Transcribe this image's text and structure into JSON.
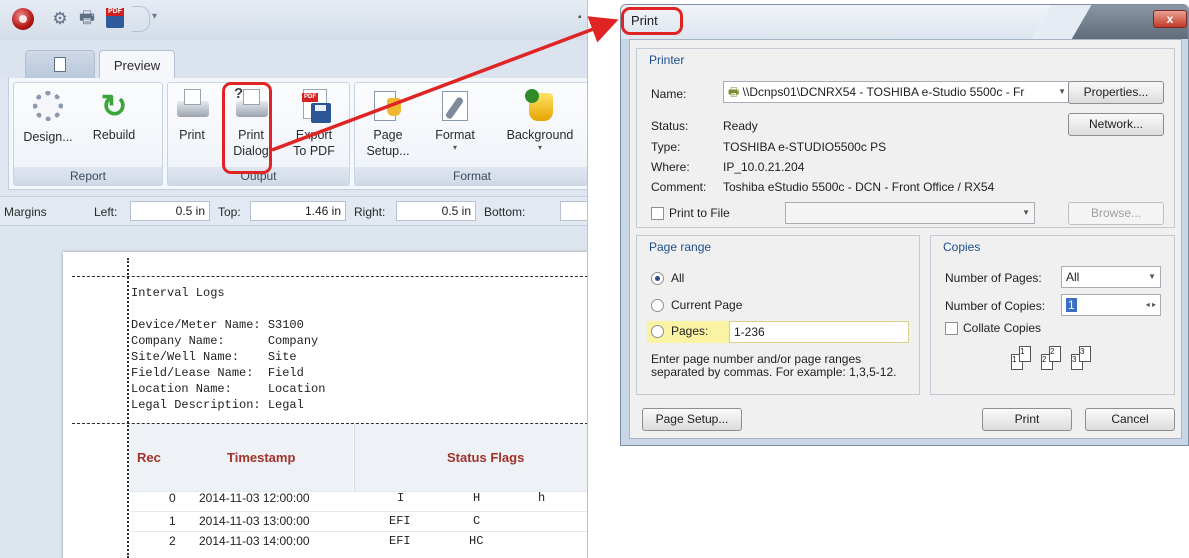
{
  "app": {
    "tabs": {
      "preview": "Preview"
    },
    "ribbon": {
      "report": {
        "label": "Report",
        "design": "Design...",
        "rebuild": "Rebuild"
      },
      "output": {
        "label": "Output",
        "print": "Print",
        "print_dialog_1": "Print",
        "print_dialog_2": "Dialog",
        "export_1": "Export",
        "export_2": "To PDF"
      },
      "format": {
        "label": "Format",
        "page_setup_1": "Page",
        "page_setup_2": "Setup...",
        "format": "Format",
        "background": "Background"
      }
    },
    "margins": {
      "title": "Margins",
      "left_label": "Left:",
      "left_value": "0.5 in",
      "top_label": "Top:",
      "top_value": "1.46 in",
      "right_label": "Right:",
      "right_value": "0.5 in",
      "bottom_label": "Bottom:"
    },
    "report_text": {
      "title": "Interval Logs",
      "lines": [
        "Device/Meter Name: S3100",
        "Company Name:      Company",
        "Site/Well Name:    Site",
        "Field/Lease Name:  Field",
        "Location Name:     Location",
        "Legal Description: Legal"
      ]
    },
    "grid": {
      "headers": {
        "rec": "Rec",
        "timestamp": "Timestamp",
        "status": "Status Flags"
      },
      "rows": [
        {
          "rec": "0",
          "timestamp": "2014-11-03 12:00:00",
          "f1": "I",
          "f2": "H",
          "f3": "h"
        },
        {
          "rec": "1",
          "timestamp": "2014-11-03 13:00:00",
          "f1": "EFI",
          "f2": "C",
          "f3": ""
        },
        {
          "rec": "2",
          "timestamp": "2014-11-03 14:00:00",
          "f1": "EFI",
          "f2": "HC",
          "f3": ""
        }
      ]
    }
  },
  "dialog": {
    "title": "Print",
    "close": "x",
    "printer": {
      "section": "Printer",
      "name_label": "Name:",
      "name_value": "\\\\Dcnps01\\DCNRX54 - TOSHIBA e-Studio 5500c - Fr",
      "properties": "Properties...",
      "network": "Network...",
      "status_label": "Status:",
      "status_value": "Ready",
      "type_label": "Type:",
      "type_value": "TOSHIBA e-STUDIO5500c PS",
      "where_label": "Where:",
      "where_value": "IP_10.0.21.204",
      "comment_label": "Comment:",
      "comment_value": "Toshiba eStudio 5500c - DCN - Front Office / RX54",
      "print_to_file": "Print to File",
      "browse": "Browse..."
    },
    "page_range": {
      "section": "Page range",
      "all": "All",
      "current": "Current Page",
      "pages": "Pages:",
      "pages_value": "1-236",
      "hint_1": "Enter page number and/or page ranges",
      "hint_2": "separated by commas. For example: 1,3,5-12."
    },
    "copies": {
      "section": "Copies",
      "num_pages_label": "Number of Pages:",
      "num_pages_value": "All",
      "num_copies_label": "Number of Copies:",
      "num_copies_value": "1",
      "collate": "Collate Copies",
      "collate_marks": [
        "1",
        "1",
        "2",
        "2",
        "3",
        "3"
      ]
    },
    "buttons": {
      "page_setup": "Page Setup...",
      "print": "Print",
      "cancel": "Cancel"
    }
  },
  "colors": {
    "highlight": "#e02424",
    "field_yellow": "#fbf3a4",
    "grid_header_text": "#a2322a"
  }
}
